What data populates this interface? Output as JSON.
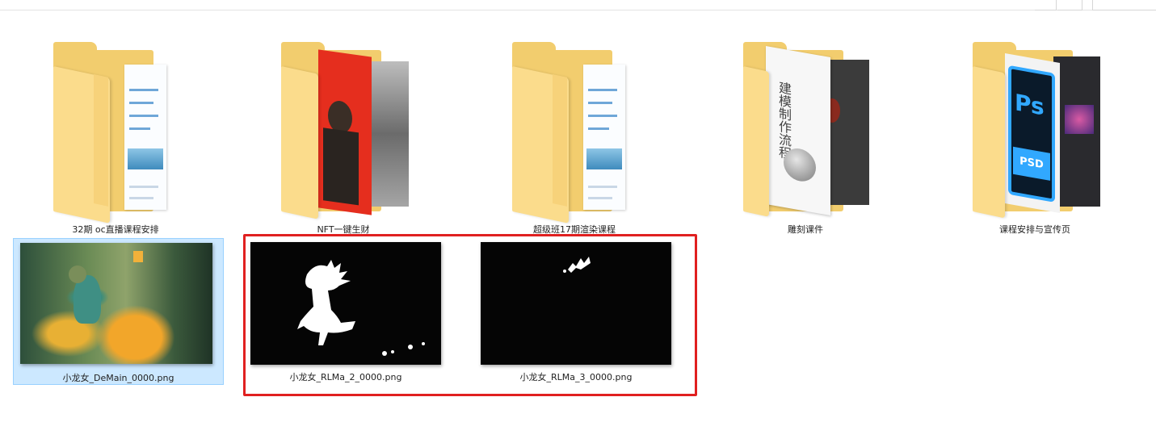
{
  "items": [
    {
      "label": "32期  oc直播课程安排",
      "type": "folder"
    },
    {
      "label": "NFT一键生财",
      "type": "folder"
    },
    {
      "label": "超级班17期渲染课程",
      "type": "folder"
    },
    {
      "label": "雕刻课件",
      "type": "folder"
    },
    {
      "label": "课程安排与宣传页",
      "type": "folder"
    },
    {
      "label": "小龙女_DeMain_0000.png",
      "type": "image",
      "selected": true
    },
    {
      "label": "小龙女_RLMa_2_0000.png",
      "type": "image"
    },
    {
      "label": "小龙女_RLMa_3_0000.png",
      "type": "image"
    }
  ],
  "previews": {
    "sculpt_text": "建模制作流程",
    "ps_icon_text": "Ps",
    "ps_icon_sub": "PSD"
  },
  "colors": {
    "folder": "#f2cd6e",
    "selection_bg": "#cce8ff",
    "highlight_border": "#e02020"
  }
}
